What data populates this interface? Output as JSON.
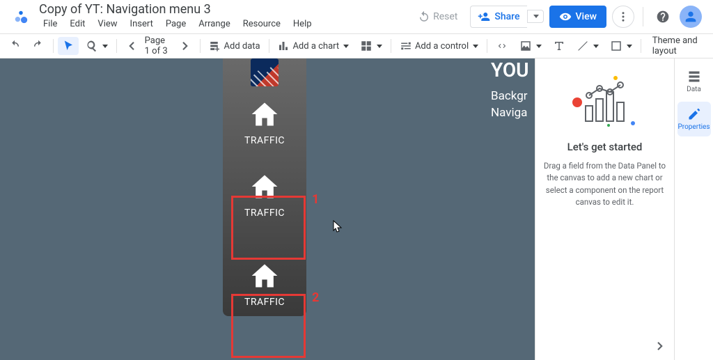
{
  "header": {
    "doc_title": "Copy of YT: Navigation menu 3",
    "menu": [
      "File",
      "Edit",
      "View",
      "Insert",
      "Page",
      "Arrange",
      "Resource",
      "Help"
    ],
    "reset": "Reset",
    "share": "Share",
    "view": "View"
  },
  "toolbar": {
    "pager": "Page 1 of 3",
    "add_data": "Add data",
    "add_chart": "Add a chart",
    "add_control": "Add a control",
    "theme": "Theme and layout"
  },
  "canvas": {
    "nav_items": [
      {
        "label": "TRAFFIC"
      },
      {
        "label": "TRAFFIC"
      },
      {
        "label": "TRAFFIC"
      }
    ],
    "annotation1": "1",
    "annotation2": "2",
    "title_fragment": "YOU",
    "line1_fragment": "Backgr",
    "line2_fragment": "Naviga"
  },
  "right_panel": {
    "title": "Let's get started",
    "body": "Drag a field from the Data Panel to the canvas to add a new chart or select a component on the report canvas to edit it."
  },
  "rail": {
    "data": "Data",
    "properties": "Properties"
  }
}
